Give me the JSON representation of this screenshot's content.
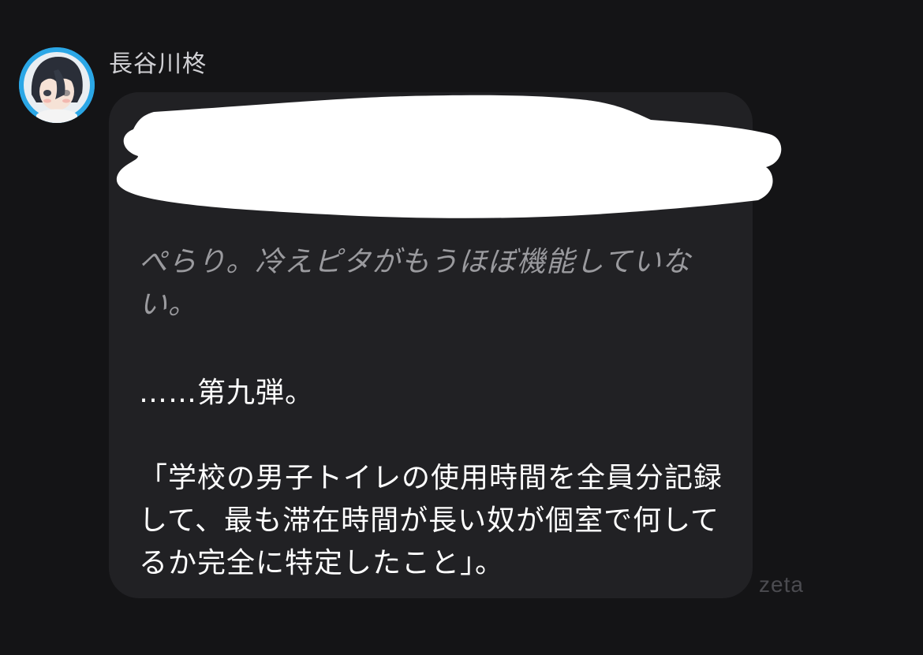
{
  "message": {
    "sender_name": "長谷川柊",
    "narration": "ぺらり。冷えピタがもうほぼ機能していない。",
    "dialogue": [
      "……第九弾。",
      "「学校の男子トイレの使用時間を全員分記録して、最も滞在時間が長い奴が個室で何してるか完全に特定したこと」。"
    ]
  },
  "watermark": "zeta",
  "colors": {
    "background": "#141416",
    "bubble": "#212124",
    "avatar_ring": "#2ba7e6",
    "narration_text": "#9a9a9e",
    "redaction": "#ffffff"
  }
}
